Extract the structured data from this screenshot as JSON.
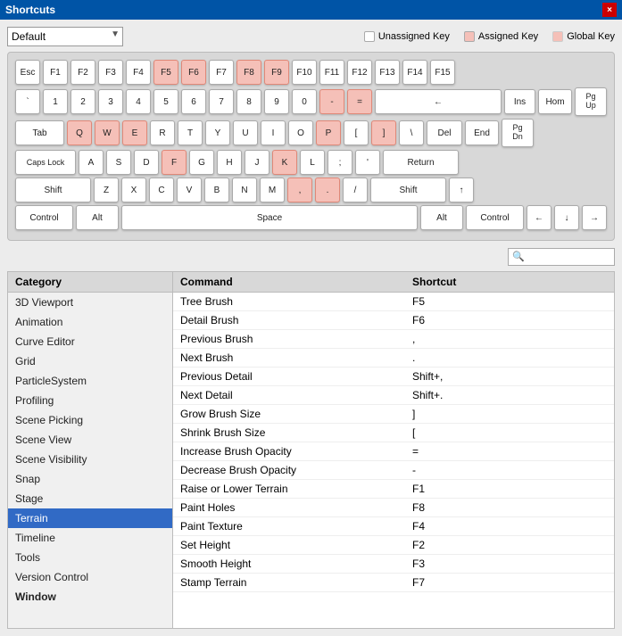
{
  "titleBar": {
    "title": "Shortcuts",
    "closeLabel": "×"
  },
  "toolbar": {
    "dropdownValue": "Default",
    "dropdownOptions": [
      "Default"
    ],
    "legend": [
      {
        "id": "unassigned",
        "label": "Unassigned Key",
        "color": "white"
      },
      {
        "id": "assigned",
        "label": "Assigned Key",
        "color": "#f5c0b8"
      },
      {
        "id": "global",
        "label": "Global Key",
        "color": "#f5c0b8"
      }
    ]
  },
  "keyboard": {
    "rows": [
      {
        "id": "row-esc-fkeys",
        "keys": [
          {
            "id": "esc",
            "label": "Esc",
            "assigned": false
          },
          {
            "id": "f1",
            "label": "F1",
            "assigned": false
          },
          {
            "id": "f2",
            "label": "F2",
            "assigned": false
          },
          {
            "id": "f3",
            "label": "F3",
            "assigned": false
          },
          {
            "id": "f4",
            "label": "F4",
            "assigned": false
          },
          {
            "id": "f5",
            "label": "F5",
            "assigned": true
          },
          {
            "id": "f6",
            "label": "F6",
            "assigned": true
          },
          {
            "id": "f7",
            "label": "F7",
            "assigned": false
          },
          {
            "id": "f8",
            "label": "F8",
            "assigned": true
          },
          {
            "id": "f9",
            "label": "F9",
            "assigned": true
          },
          {
            "id": "f10",
            "label": "F10",
            "assigned": false
          },
          {
            "id": "f11",
            "label": "F11",
            "assigned": false
          },
          {
            "id": "f12",
            "label": "F12",
            "assigned": false
          },
          {
            "id": "f13",
            "label": "F13",
            "assigned": false
          },
          {
            "id": "f14",
            "label": "F14",
            "assigned": false
          },
          {
            "id": "f15",
            "label": "F15",
            "assigned": false
          }
        ]
      },
      {
        "id": "row-numbers",
        "keys": [
          {
            "id": "backtick",
            "label": "`",
            "assigned": false
          },
          {
            "id": "1",
            "label": "1",
            "assigned": false
          },
          {
            "id": "2",
            "label": "2",
            "assigned": false
          },
          {
            "id": "3",
            "label": "3",
            "assigned": false
          },
          {
            "id": "4",
            "label": "4",
            "assigned": false
          },
          {
            "id": "5",
            "label": "5",
            "assigned": false
          },
          {
            "id": "6",
            "label": "6",
            "assigned": false
          },
          {
            "id": "7",
            "label": "7",
            "assigned": false
          },
          {
            "id": "8",
            "label": "8",
            "assigned": false
          },
          {
            "id": "9",
            "label": "9",
            "assigned": false
          },
          {
            "id": "0",
            "label": "0",
            "assigned": false
          },
          {
            "id": "minus",
            "label": "-",
            "assigned": true
          },
          {
            "id": "equals",
            "label": "=",
            "assigned": true
          },
          {
            "id": "backspace",
            "label": "←",
            "assigned": false,
            "wide": "backspace"
          }
        ]
      },
      {
        "id": "row-qwerty",
        "keys": [
          {
            "id": "tab",
            "label": "Tab",
            "assigned": false,
            "wide": "wide-tab"
          },
          {
            "id": "q",
            "label": "Q",
            "assigned": true
          },
          {
            "id": "w",
            "label": "W",
            "assigned": true
          },
          {
            "id": "e",
            "label": "E",
            "assigned": true
          },
          {
            "id": "r",
            "label": "R",
            "assigned": false
          },
          {
            "id": "t",
            "label": "T",
            "assigned": false
          },
          {
            "id": "y",
            "label": "Y",
            "assigned": false
          },
          {
            "id": "u",
            "label": "U",
            "assigned": false
          },
          {
            "id": "i",
            "label": "I",
            "assigned": false
          },
          {
            "id": "o",
            "label": "O",
            "assigned": false
          },
          {
            "id": "p",
            "label": "P",
            "assigned": true
          },
          {
            "id": "lbracket",
            "label": "[",
            "assigned": false
          },
          {
            "id": "rbracket",
            "label": "]",
            "assigned": true
          },
          {
            "id": "backslash",
            "label": "\\",
            "assigned": false
          },
          {
            "id": "del",
            "label": "Del",
            "assigned": false,
            "wide": "wide-del"
          },
          {
            "id": "end",
            "label": "End",
            "assigned": false,
            "wide": "wide-end"
          }
        ]
      },
      {
        "id": "row-asdf",
        "keys": [
          {
            "id": "capslock",
            "label": "Caps Lock",
            "assigned": false,
            "wide": "wide-caps"
          },
          {
            "id": "a",
            "label": "A",
            "assigned": false
          },
          {
            "id": "s",
            "label": "S",
            "assigned": false
          },
          {
            "id": "d",
            "label": "D",
            "assigned": false
          },
          {
            "id": "f",
            "label": "F",
            "assigned": true
          },
          {
            "id": "g",
            "label": "G",
            "assigned": false
          },
          {
            "id": "h",
            "label": "H",
            "assigned": false
          },
          {
            "id": "j",
            "label": "J",
            "assigned": false
          },
          {
            "id": "k",
            "label": "K",
            "assigned": true
          },
          {
            "id": "l",
            "label": "L",
            "assigned": false
          },
          {
            "id": "semicolon",
            "label": ";",
            "assigned": false
          },
          {
            "id": "apostrophe",
            "label": "'",
            "assigned": false
          },
          {
            "id": "return",
            "label": "Return",
            "assigned": false,
            "wide": "wide-return"
          }
        ]
      },
      {
        "id": "row-zxcv",
        "keys": [
          {
            "id": "shift-l",
            "label": "Shift",
            "assigned": false,
            "wide": "wide-shift-l"
          },
          {
            "id": "z",
            "label": "Z",
            "assigned": false
          },
          {
            "id": "x",
            "label": "X",
            "assigned": false
          },
          {
            "id": "c",
            "label": "C",
            "assigned": false
          },
          {
            "id": "v",
            "label": "V",
            "assigned": false
          },
          {
            "id": "b",
            "label": "B",
            "assigned": false
          },
          {
            "id": "n",
            "label": "N",
            "assigned": false
          },
          {
            "id": "m",
            "label": "M",
            "assigned": false
          },
          {
            "id": "comma",
            "label": ",",
            "assigned": true
          },
          {
            "id": "period",
            "label": ".",
            "assigned": true
          },
          {
            "id": "slash",
            "label": "/",
            "assigned": false
          },
          {
            "id": "shift-r",
            "label": "Shift",
            "assigned": false,
            "wide": "wide-shift-r"
          },
          {
            "id": "up",
            "label": "↑",
            "assigned": false,
            "arrow": true
          }
        ]
      },
      {
        "id": "row-bottom",
        "keys": [
          {
            "id": "ctrl-l",
            "label": "Control",
            "assigned": false,
            "wide": "wide-ctrl"
          },
          {
            "id": "alt-l",
            "label": "Alt",
            "assigned": false,
            "wide": "wide-alt"
          },
          {
            "id": "space",
            "label": "Space",
            "assigned": false,
            "wide": "wide-space"
          },
          {
            "id": "alt-r",
            "label": "Alt",
            "assigned": false,
            "wide": "wide-alt"
          },
          {
            "id": "ctrl-r",
            "label": "Control",
            "assigned": false,
            "wide": "wide-ctrl"
          },
          {
            "id": "left",
            "label": "←",
            "assigned": false,
            "arrow": true
          },
          {
            "id": "down",
            "label": "↓",
            "assigned": false,
            "arrow": true
          },
          {
            "id": "right",
            "label": "→",
            "assigned": false,
            "arrow": true
          }
        ]
      }
    ],
    "rightKeys": {
      "insHom": [
        {
          "id": "ins",
          "label": "Ins",
          "wide": "wide-ins"
        },
        {
          "id": "hom",
          "label": "Hom",
          "wide": "wide-home"
        }
      ],
      "pgUp": {
        "id": "pgup",
        "label": "Pg\nUp",
        "wide": "wide-pgup"
      },
      "pgDn": {
        "id": "pgdn",
        "label": "Pg\nDn",
        "wide": "wide-pgdn"
      }
    }
  },
  "search": {
    "placeholder": "🔍",
    "value": ""
  },
  "categories": {
    "header": "Category",
    "items": [
      {
        "id": "3d-viewport",
        "label": "3D Viewport",
        "selected": false,
        "bold": false
      },
      {
        "id": "animation",
        "label": "Animation",
        "selected": false,
        "bold": false
      },
      {
        "id": "curve-editor",
        "label": "Curve Editor",
        "selected": false,
        "bold": false
      },
      {
        "id": "grid",
        "label": "Grid",
        "selected": false,
        "bold": false
      },
      {
        "id": "particle-system",
        "label": "ParticleSystem",
        "selected": false,
        "bold": false
      },
      {
        "id": "profiling",
        "label": "Profiling",
        "selected": false,
        "bold": false
      },
      {
        "id": "scene-picking",
        "label": "Scene Picking",
        "selected": false,
        "bold": false
      },
      {
        "id": "scene-view",
        "label": "Scene View",
        "selected": false,
        "bold": false
      },
      {
        "id": "scene-visibility",
        "label": "Scene Visibility",
        "selected": false,
        "bold": false
      },
      {
        "id": "snap",
        "label": "Snap",
        "selected": false,
        "bold": false
      },
      {
        "id": "stage",
        "label": "Stage",
        "selected": false,
        "bold": false
      },
      {
        "id": "terrain",
        "label": "Terrain",
        "selected": true,
        "bold": false
      },
      {
        "id": "timeline",
        "label": "Timeline",
        "selected": false,
        "bold": false
      },
      {
        "id": "tools",
        "label": "Tools",
        "selected": false,
        "bold": false
      },
      {
        "id": "version-control",
        "label": "Version Control",
        "selected": false,
        "bold": false
      },
      {
        "id": "window",
        "label": "Window",
        "selected": false,
        "bold": true
      }
    ]
  },
  "commands": {
    "commandHeader": "Command",
    "shortcutHeader": "Shortcut",
    "items": [
      {
        "command": "Tree Brush",
        "shortcut": "F5"
      },
      {
        "command": "Detail Brush",
        "shortcut": "F6"
      },
      {
        "command": "Previous Brush",
        "shortcut": ","
      },
      {
        "command": "Next Brush",
        "shortcut": "."
      },
      {
        "command": "Previous Detail",
        "shortcut": "Shift+,"
      },
      {
        "command": "Next Detail",
        "shortcut": "Shift+."
      },
      {
        "command": "Grow Brush Size",
        "shortcut": "]"
      },
      {
        "command": "Shrink Brush Size",
        "shortcut": "["
      },
      {
        "command": "Increase Brush Opacity",
        "shortcut": "="
      },
      {
        "command": "Decrease Brush Opacity",
        "shortcut": "-"
      },
      {
        "command": "Raise or Lower Terrain",
        "shortcut": "F1"
      },
      {
        "command": "Paint Holes",
        "shortcut": "F8"
      },
      {
        "command": "Paint Texture",
        "shortcut": "F4"
      },
      {
        "command": "Set Height",
        "shortcut": "F2"
      },
      {
        "command": "Smooth Height",
        "shortcut": "F3"
      },
      {
        "command": "Stamp Terrain",
        "shortcut": "F7"
      }
    ]
  }
}
